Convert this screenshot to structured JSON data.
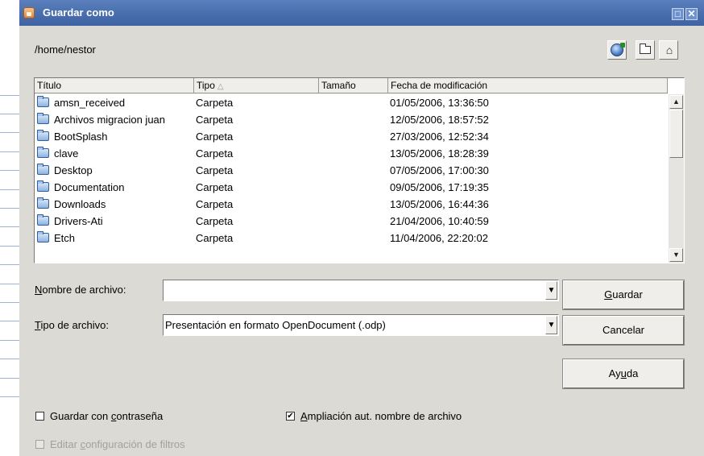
{
  "window": {
    "title": "Guardar como"
  },
  "path": "/home/nestor",
  "list": {
    "columns": [
      "Título",
      "Tipo",
      "Tamaño",
      "Fecha de modificación"
    ],
    "sort_indicator": "△",
    "rows": [
      {
        "name": "amsn_received",
        "type": "Carpeta",
        "size": "",
        "date": "01/05/2006, 13:36:50"
      },
      {
        "name": "Archivos migracion juan",
        "type": "Carpeta",
        "size": "",
        "date": "12/05/2006, 18:57:52"
      },
      {
        "name": "BootSplash",
        "type": "Carpeta",
        "size": "",
        "date": "27/03/2006, 12:52:34"
      },
      {
        "name": "clave",
        "type": "Carpeta",
        "size": "",
        "date": "13/05/2006, 18:28:39"
      },
      {
        "name": "Desktop",
        "type": "Carpeta",
        "size": "",
        "date": "07/05/2006, 17:00:30"
      },
      {
        "name": "Documentation",
        "type": "Carpeta",
        "size": "",
        "date": "09/05/2006, 17:19:35"
      },
      {
        "name": "Downloads",
        "type": "Carpeta",
        "size": "",
        "date": "13/05/2006, 16:44:36"
      },
      {
        "name": "Drivers-Ati",
        "type": "Carpeta",
        "size": "",
        "date": "21/04/2006, 10:40:59"
      },
      {
        "name": "Etch",
        "type": "Carpeta",
        "size": "",
        "date": "11/04/2006, 22:20:02"
      }
    ]
  },
  "filename": {
    "label_before": "",
    "label_mnemonic": "N",
    "label_after": "ombre de archivo:",
    "value": ""
  },
  "filetype": {
    "label_before": "",
    "label_mnemonic": "T",
    "label_after": "ipo de archivo:",
    "value": "Presentación en formato OpenDocument (.odp)"
  },
  "buttons": {
    "save": {
      "before": "",
      "mnemonic": "G",
      "after": "uardar"
    },
    "cancel": {
      "label": "Cancelar"
    },
    "help": {
      "before": "Ay",
      "mnemonic": "u",
      "after": "da"
    }
  },
  "options": {
    "password": {
      "before": "Guardar con ",
      "mnemonic": "c",
      "after": "ontraseña",
      "checked": false
    },
    "auto_ext": {
      "before": "",
      "mnemonic": "A",
      "after": "mpliación aut. nombre de archivo",
      "checked": true
    },
    "filter": {
      "before": "Editar ",
      "mnemonic": "c",
      "after": "onfiguración de filtros",
      "checked": false,
      "enabled": false
    }
  },
  "check_glyph": "✔",
  "icons": [
    "app-icon",
    "globe-icon",
    "folder-new-icon",
    "home-icon",
    "folder-icon",
    "chevron-down-icon",
    "close-icon",
    "maximize-icon"
  ]
}
